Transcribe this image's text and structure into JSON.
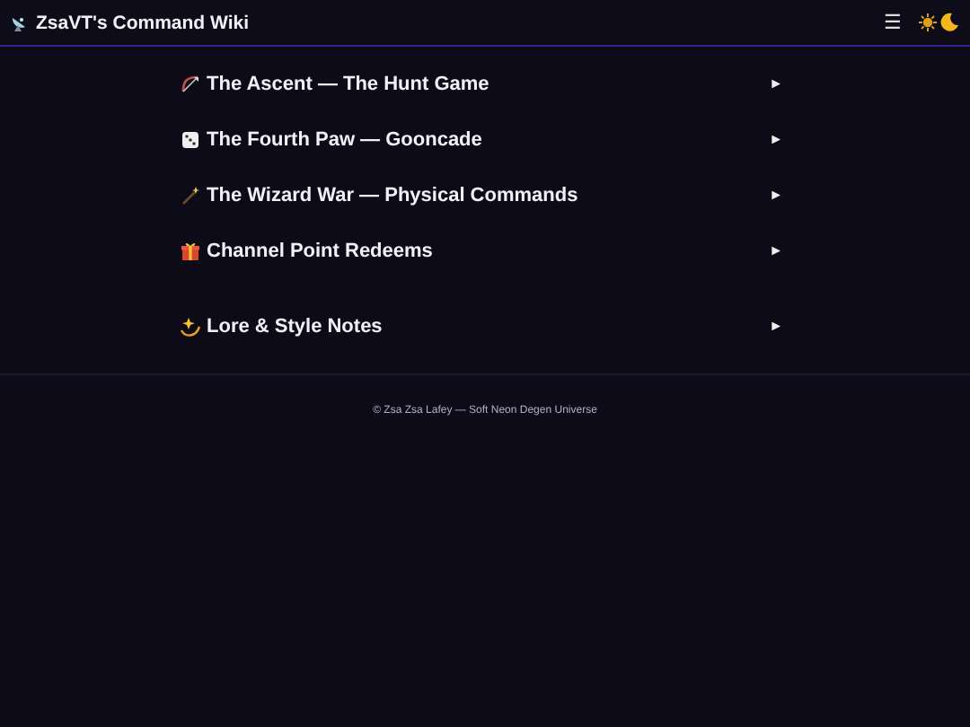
{
  "header": {
    "title": "ZsaVT's Command Wiki",
    "menu_glyph": "☰"
  },
  "sections": [
    {
      "items": [
        {
          "kind": "bow",
          "label": "The Ascent — The Hunt Game",
          "arrow": "►"
        },
        {
          "kind": "dice",
          "label": "The Fourth Paw — Gooncade",
          "arrow": "►"
        },
        {
          "kind": "wand",
          "label": "The Wizard War — Physical Commands",
          "arrow": "►"
        },
        {
          "kind": "gift",
          "label": "Channel Point Redeems",
          "arrow": "►"
        }
      ]
    },
    {
      "items": [
        {
          "kind": "sparkle",
          "label": "Lore & Style Notes",
          "arrow": "►"
        }
      ]
    }
  ],
  "footer": "© Zsa Zsa Lafey — Soft Neon Degen Universe"
}
